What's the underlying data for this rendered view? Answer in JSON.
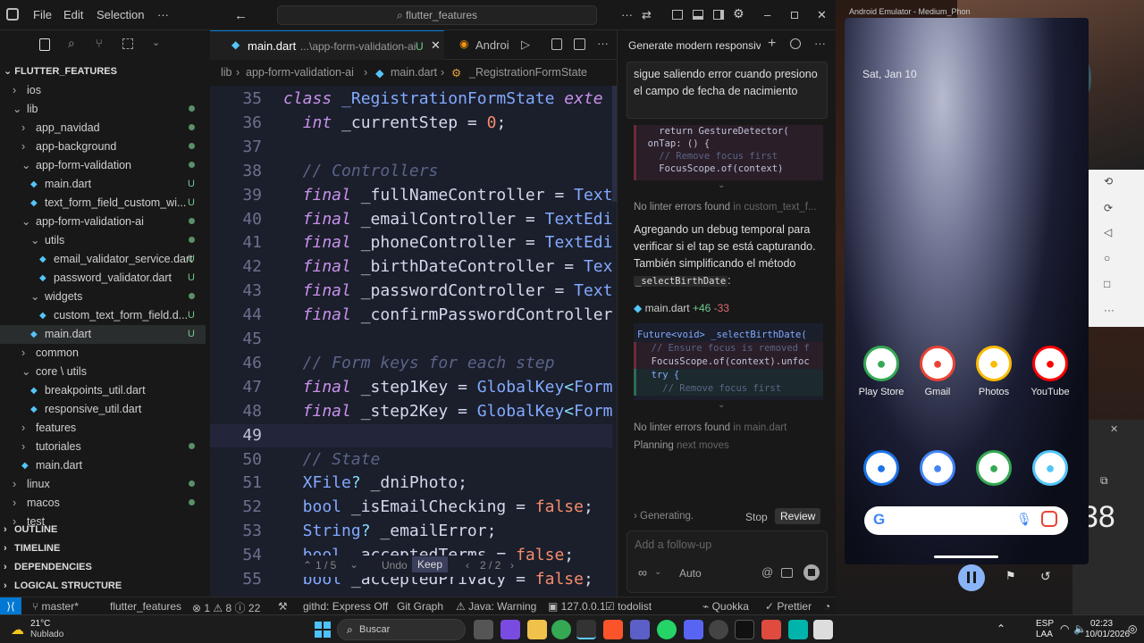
{
  "titlebar": {
    "menus": [
      "File",
      "Edit",
      "Selection",
      "···"
    ],
    "search": "flutter_features"
  },
  "tabs": [
    {
      "label": "main.dart",
      "path": "...\\app-form-validation-ai",
      "badge": "U"
    },
    {
      "label": "Androi"
    }
  ],
  "breadcrumbs": [
    "lib",
    "app-form-validation-ai",
    "main.dart",
    "_RegistrationFormState"
  ],
  "explorer": {
    "title": "FLUTTER_FEATURES",
    "items": [
      {
        "label": "ios",
        "indent": 1,
        "kind": "folder",
        "open": false
      },
      {
        "label": "lib",
        "indent": 1,
        "kind": "folder",
        "open": true,
        "status": "dot"
      },
      {
        "label": "app_navidad",
        "indent": 2,
        "kind": "folder",
        "open": false,
        "status": "dot"
      },
      {
        "label": "app-background",
        "indent": 2,
        "kind": "folder",
        "open": false,
        "status": "dot"
      },
      {
        "label": "app-form-validation",
        "indent": 2,
        "kind": "folder",
        "open": true,
        "status": "dot"
      },
      {
        "label": "main.dart",
        "indent": 3,
        "kind": "dart",
        "status": "U"
      },
      {
        "label": "text_form_field_custom_wi...",
        "indent": 3,
        "kind": "dart",
        "status": "U"
      },
      {
        "label": "app-form-validation-ai",
        "indent": 2,
        "kind": "folder",
        "open": true,
        "status": "dot"
      },
      {
        "label": "utils",
        "indent": 3,
        "kind": "folder",
        "open": true,
        "status": "dot"
      },
      {
        "label": "email_validator_service.dart",
        "indent": 4,
        "kind": "dart",
        "status": "U"
      },
      {
        "label": "password_validator.dart",
        "indent": 4,
        "kind": "dart",
        "status": "U"
      },
      {
        "label": "widgets",
        "indent": 3,
        "kind": "folder",
        "open": true,
        "status": "dot"
      },
      {
        "label": "custom_text_form_field.d...",
        "indent": 4,
        "kind": "dart",
        "status": "U"
      },
      {
        "label": "main.dart",
        "indent": 3,
        "kind": "dart",
        "status": "U",
        "selected": true
      },
      {
        "label": "common",
        "indent": 2,
        "kind": "folder",
        "open": false
      },
      {
        "label": "core \\ utils",
        "indent": 2,
        "kind": "folder",
        "open": true
      },
      {
        "label": "breakpoints_util.dart",
        "indent": 3,
        "kind": "dart"
      },
      {
        "label": "responsive_util.dart",
        "indent": 3,
        "kind": "dart"
      },
      {
        "label": "features",
        "indent": 2,
        "kind": "folder",
        "open": false
      },
      {
        "label": "tutoriales",
        "indent": 2,
        "kind": "folder",
        "open": false,
        "status": "dot"
      },
      {
        "label": "main.dart",
        "indent": 2,
        "kind": "dart"
      },
      {
        "label": "linux",
        "indent": 1,
        "kind": "folder",
        "open": false,
        "status": "dot"
      },
      {
        "label": "macos",
        "indent": 1,
        "kind": "folder",
        "open": false,
        "status": "dot"
      },
      {
        "label": "test",
        "indent": 1,
        "kind": "folder",
        "open": false
      }
    ],
    "sections": [
      "OUTLINE",
      "TIMELINE",
      "DEPENDENCIES",
      "LOGICAL STRUCTURE"
    ]
  },
  "editor": {
    "lines": [
      {
        "n": "35",
        "t": [
          [
            "kw",
            "class "
          ],
          [
            "ty",
            "_RegistrationFormState "
          ],
          [
            "kw",
            "exte"
          ]
        ]
      },
      {
        "n": "36",
        "t": [
          [
            "",
            "  "
          ],
          [
            "kw",
            "int "
          ],
          [
            "",
            "_currentStep = "
          ],
          [
            "nu",
            "0"
          ],
          [
            "",
            ";"
          ]
        ]
      },
      {
        "n": "37",
        "t": []
      },
      {
        "n": "38",
        "t": [
          [
            "cm",
            "  // Controllers"
          ]
        ]
      },
      {
        "n": "39",
        "t": [
          [
            "kw",
            "  final "
          ],
          [
            "",
            "_fullNameController = "
          ],
          [
            "ty",
            "Text"
          ]
        ]
      },
      {
        "n": "40",
        "t": [
          [
            "kw",
            "  final "
          ],
          [
            "",
            "_emailController = "
          ],
          [
            "ty",
            "TextEdi"
          ]
        ]
      },
      {
        "n": "41",
        "t": [
          [
            "kw",
            "  final "
          ],
          [
            "",
            "_phoneController = "
          ],
          [
            "ty",
            "TextEdi"
          ]
        ]
      },
      {
        "n": "42",
        "t": [
          [
            "kw",
            "  final "
          ],
          [
            "",
            "_birthDateController = "
          ],
          [
            "ty",
            "Tex"
          ]
        ]
      },
      {
        "n": "43",
        "t": [
          [
            "kw",
            "  final "
          ],
          [
            "",
            "_passwordController = "
          ],
          [
            "ty",
            "Text"
          ]
        ]
      },
      {
        "n": "44",
        "t": [
          [
            "kw",
            "  final "
          ],
          [
            "",
            "_confirmPasswordController"
          ]
        ]
      },
      {
        "n": "45",
        "t": []
      },
      {
        "n": "46",
        "t": [
          [
            "cm",
            "  // Form keys for each step"
          ]
        ]
      },
      {
        "n": "47",
        "t": [
          [
            "kw",
            "  final "
          ],
          [
            "",
            "_step1Key = "
          ],
          [
            "ty",
            "GlobalKey"
          ],
          [
            "tk",
            "<"
          ],
          [
            "ty",
            "Form"
          ]
        ]
      },
      {
        "n": "48",
        "t": [
          [
            "kw",
            "  final "
          ],
          [
            "",
            "_step2Key = "
          ],
          [
            "ty",
            "GlobalKey"
          ],
          [
            "tk",
            "<"
          ],
          [
            "ty",
            "Form"
          ]
        ]
      },
      {
        "n": "49",
        "t": []
      },
      {
        "n": "50",
        "t": [
          [
            "cm",
            "  // State"
          ]
        ]
      },
      {
        "n": "51",
        "t": [
          [
            "ty",
            "  XFile"
          ],
          [
            "tk",
            "? "
          ],
          [
            "",
            "_dniPhoto;"
          ]
        ]
      },
      {
        "n": "52",
        "t": [
          [
            "ty",
            "  bool "
          ],
          [
            "",
            "_isEmailChecking = "
          ],
          [
            "nu",
            "false"
          ],
          [
            "",
            ";"
          ]
        ]
      },
      {
        "n": "53",
        "t": [
          [
            "ty",
            "  String"
          ],
          [
            "tk",
            "? "
          ],
          [
            "",
            "_emailError;"
          ]
        ]
      },
      {
        "n": "54",
        "t": [
          [
            "ty",
            "  bool "
          ],
          [
            "",
            "_acceptedTerms = "
          ],
          [
            "nu",
            "false"
          ],
          [
            "",
            ";"
          ]
        ]
      },
      {
        "n": "55",
        "t": [
          [
            "ty",
            "  bool "
          ],
          [
            "",
            "_acceptedPrivacy = "
          ],
          [
            "nu",
            "false"
          ],
          [
            "",
            ";"
          ]
        ]
      }
    ],
    "diff_toolbar": {
      "changes": "1 / 5",
      "undo": "Undo",
      "keep": "Keep",
      "files": "2 / 2"
    }
  },
  "chat": {
    "title": "Generate modern responsive",
    "user_message": "sigue saliendo error cuando presiono el campo de fecha de nacimiento",
    "code1": [
      "    return GestureDetector(",
      "  onTap: () {",
      "    // Remove focus first",
      "    FocusScope.of(context)"
    ],
    "lint1": "No linter errors found",
    "lint1_file": "in custom_text_f...",
    "assistant_text": "Agregando un debug temporal para verificar si el tap se está capturando. También simplificando el método ",
    "assistant_code": "_selectBirthDate",
    "edit_file": "main.dart",
    "edit_add": "+46",
    "edit_del": "-33",
    "code2": [
      "Future<void> _selectBirthDate(",
      "  // Ensure focus is removed f",
      "  FocusScope.of(context).unfoc",
      "  try {",
      "    // Remove focus first"
    ],
    "lint2": "No linter errors found",
    "lint2_file": "in main.dart",
    "planning": "Planning",
    "planning_rest": "next moves",
    "generating": "Generating.",
    "stop": "Stop",
    "review": "Review",
    "input_placeholder": "Add a follow-up",
    "mode": "Auto"
  },
  "statusbar": {
    "branch": "master*",
    "project": "flutter_features",
    "errors": "1",
    "warnings": "8",
    "infos": "22",
    "action": "githd: Express Off",
    "git_graph": "Git Graph",
    "java": "Java: Warning",
    "server": "127.0.0.1",
    "todolist": "todolist",
    "quokka": "Quokka",
    "prettier": "Prettier"
  },
  "emulator": {
    "title": "Android Emulator - Medium_Phon",
    "date": "Sat, Jan 10",
    "apps_row1": [
      {
        "label": "Play Store",
        "icon": "play-store-icon",
        "color": "#34a853"
      },
      {
        "label": "Gmail",
        "icon": "gmail-icon",
        "color": "#ea4335"
      },
      {
        "label": "Photos",
        "icon": "photos-icon",
        "color": "#fbbc04"
      },
      {
        "label": "YouTube",
        "icon": "youtube-icon",
        "color": "#ff0000"
      }
    ],
    "apps_row2": [
      {
        "label": "",
        "icon": "phone-icon",
        "color": "#1a73e8"
      },
      {
        "label": "",
        "icon": "messages-icon",
        "color": "#4285f4"
      },
      {
        "label": "",
        "icon": "chrome-icon",
        "color": "#34a853"
      },
      {
        "label": "",
        "icon": "flutter-icon",
        "color": "#54c5f8"
      }
    ],
    "side_clock": "38"
  },
  "taskbar": {
    "weather_temp": "21°C",
    "weather_desc": "Nublado",
    "search": "Buscar",
    "lang": "ESP",
    "lang2": "LAA",
    "time": "02:23",
    "date": "10/01/2026"
  },
  "colors": {
    "accent": "#0078d4",
    "keyword": "#c792ea",
    "type": "#82aaff",
    "comment": "#5a6487",
    "number": "#f78c6c"
  }
}
